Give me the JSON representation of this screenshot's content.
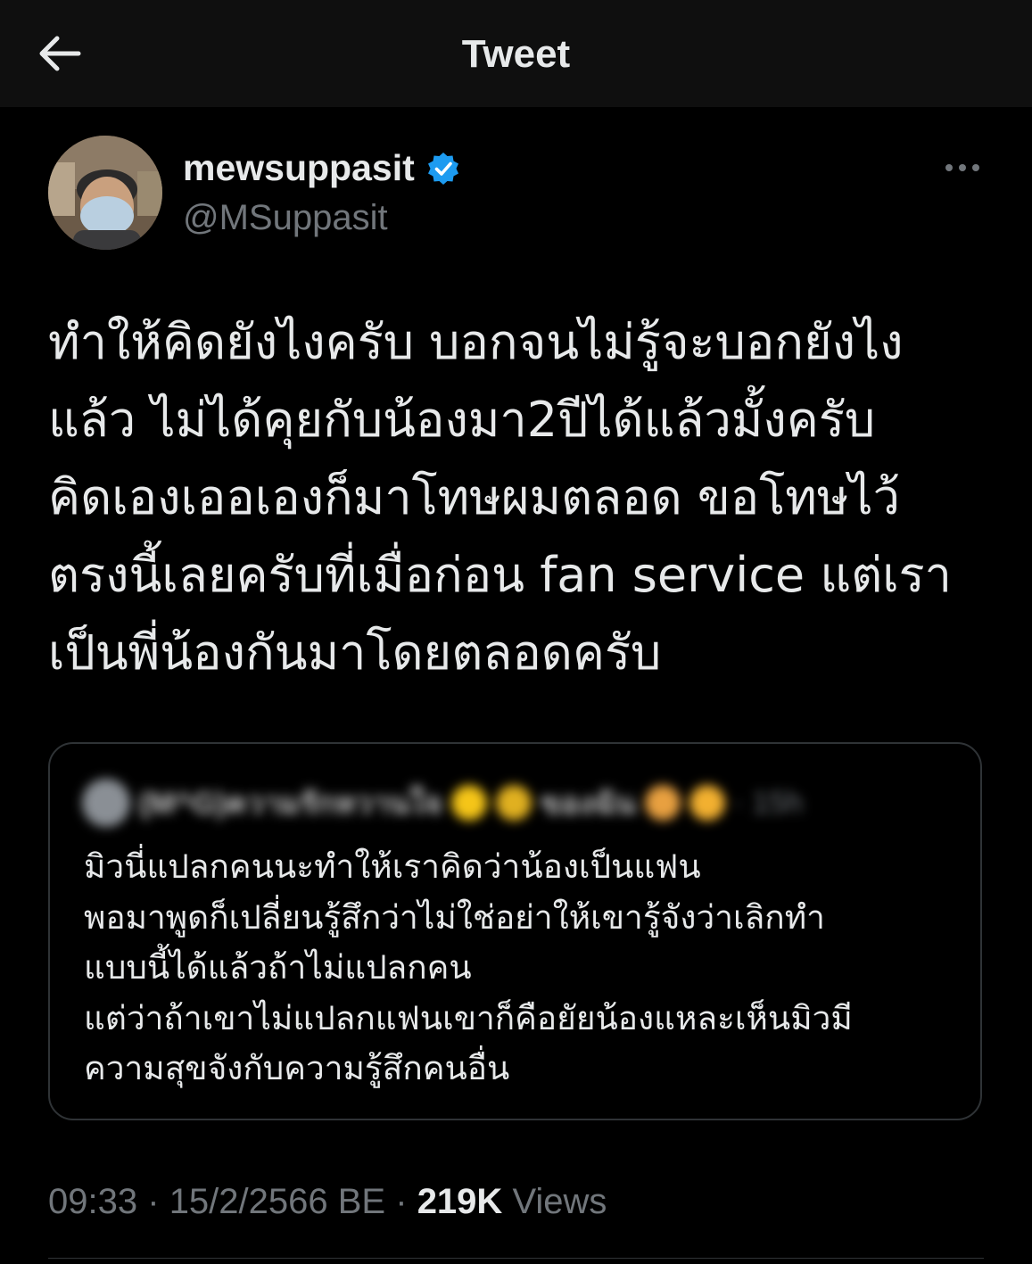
{
  "header": {
    "title": "Tweet",
    "back_icon": "arrow-left-icon"
  },
  "author": {
    "display_name": "mewsuppasit",
    "handle": "@MSuppasit",
    "verified": true,
    "verified_color": "#1d9bf0"
  },
  "tweet": {
    "lines": [
      "ทำให้คิดยังไงครับ บอกจนไม่รู้จะบอกยังไง",
      "แล้ว ไม่ได้คุยกับน้องมา2ปีได้แล้วมั้งครับ",
      "คิดเองเออเองก็มาโทษผมตลอด ขอโทษไว้",
      "ตรงนี้เลยครับที่เมื่อก่อน fan service แต่เรา",
      "เป็นพี่น้องกันมาโดยตลอดครับ"
    ]
  },
  "quote": {
    "author": "(M^G)ความรักหวานใจ",
    "author_extra": "ของฉัน",
    "time": "· 15h",
    "lines": [
      "มิวนี่แปลกคนนะทำให้เราคิดว่าน้องเป็นแฟน",
      "พอมาพูดก็เปลี่ยนรู้สึกว่าไม่ใช่อย่าให้เขารู้จังว่าเลิกทำ",
      "แบบนี้ได้แล้วถ้าไม่แปลกคน",
      "แต่ว่าถ้าเขาไม่แปลกแฟนเขาก็คือยัยน้องแหละเห็นมิวมี",
      "ความสุขจังกับความรู้สึกคนอื่น"
    ]
  },
  "meta": {
    "time": "09:33",
    "sep1": "·",
    "date": "15/2/2566 BE",
    "sep2": "·",
    "views_count": "219K",
    "views_label": "Views"
  },
  "colors": {
    "background": "#000000",
    "header_bg": "#0f0f0f",
    "text": "#e7e9ea",
    "muted": "#71767b",
    "border": "#2f3336"
  }
}
